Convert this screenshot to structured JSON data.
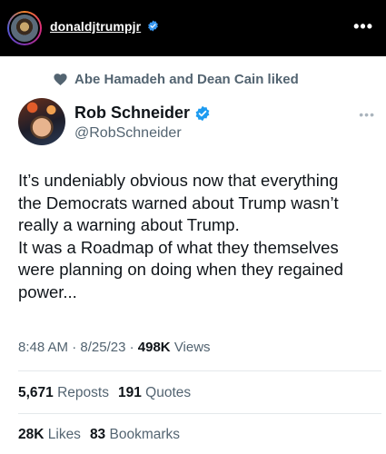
{
  "instagram": {
    "username": "donaldjtrumpjr",
    "more_icon": "more-horizontal-icon",
    "more_glyph": "•••"
  },
  "liked": {
    "icon": "heart-icon",
    "text": "Abe Hamadeh and Dean Cain liked"
  },
  "tweet": {
    "author_name": "Rob Schneider",
    "handle": "@RobSchneider",
    "more_glyph": "•••",
    "lines": [
      "It’s undeniably obvious now that everything",
      "the Democrats warned about Trump wasn’t",
      "really a warning about Trump.",
      "It was a Roadmap of what they themselves",
      "were planning on doing when they regained",
      "power..."
    ],
    "time": "8:48 AM",
    "date": "8/25/23",
    "separator": "·",
    "views_count": "498K",
    "views_label": "Views",
    "reposts_count": "5,671",
    "reposts_label": "Reposts",
    "quotes_count": "191",
    "quotes_label": "Quotes",
    "likes_count": "28K",
    "likes_label": "Likes",
    "bookmarks_count": "83",
    "bookmarks_label": "Bookmarks"
  },
  "colors": {
    "verified_blue": "#1d9bf0",
    "secondary_text": "#536471",
    "primary_text": "#0f1419",
    "header_bg": "#000000"
  }
}
